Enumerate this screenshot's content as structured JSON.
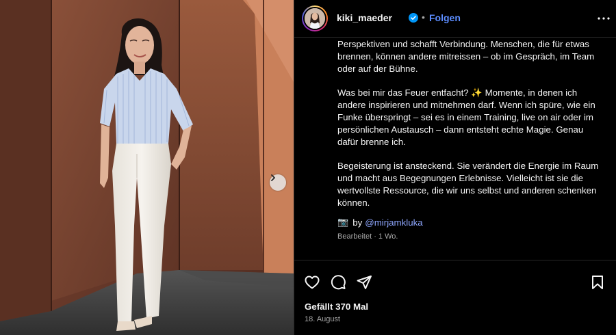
{
  "header": {
    "username": "kiki_maeder",
    "separator": "•",
    "follow_label": "Folgen",
    "verified_icon": "verified-badge-icon",
    "more_icon": "more-options-icon"
  },
  "caption": {
    "paragraphs": [
      "Perspektiven und schafft Verbindung. Menschen, die für etwas brennen, können andere mitreissen – ob im Gespräch, im Team oder auf der Bühne.",
      "Was bei mir das Feuer entfacht? ✨ Momente, in denen ich andere inspirieren und mitnehmen darf. Wenn ich spüre, wie ein Funke überspringt – sei es in einem Training, live on air oder im persönlichen Austausch – dann entsteht echte Magie. Genau dafür brenne ich.",
      "Begeisterung ist ansteckend. Sie verändert die Energie im Raum und macht aus Begegnungen Erlebnisse. Vielleicht ist sie die wertvollste Ressource, die wir uns selbst und anderen schenken können."
    ],
    "credit_emoji": "📷",
    "credit_by": "by",
    "credit_mention": "@mirjamkluka",
    "edited": "Bearbeitet · 1 Wo."
  },
  "actions": {
    "icons": [
      "heart-icon",
      "comment-icon",
      "share-icon",
      "bookmark-icon"
    ],
    "likes": "Gefällt 370 Mal",
    "date": "18. August"
  },
  "media": {
    "carousel_icon": "chevron-right-icon"
  },
  "colors": {
    "accent_link": "#5c8dff",
    "mention": "#8fa7ff",
    "background": "#000000",
    "text": "#f5f5f5",
    "muted": "#a8a8a8"
  }
}
